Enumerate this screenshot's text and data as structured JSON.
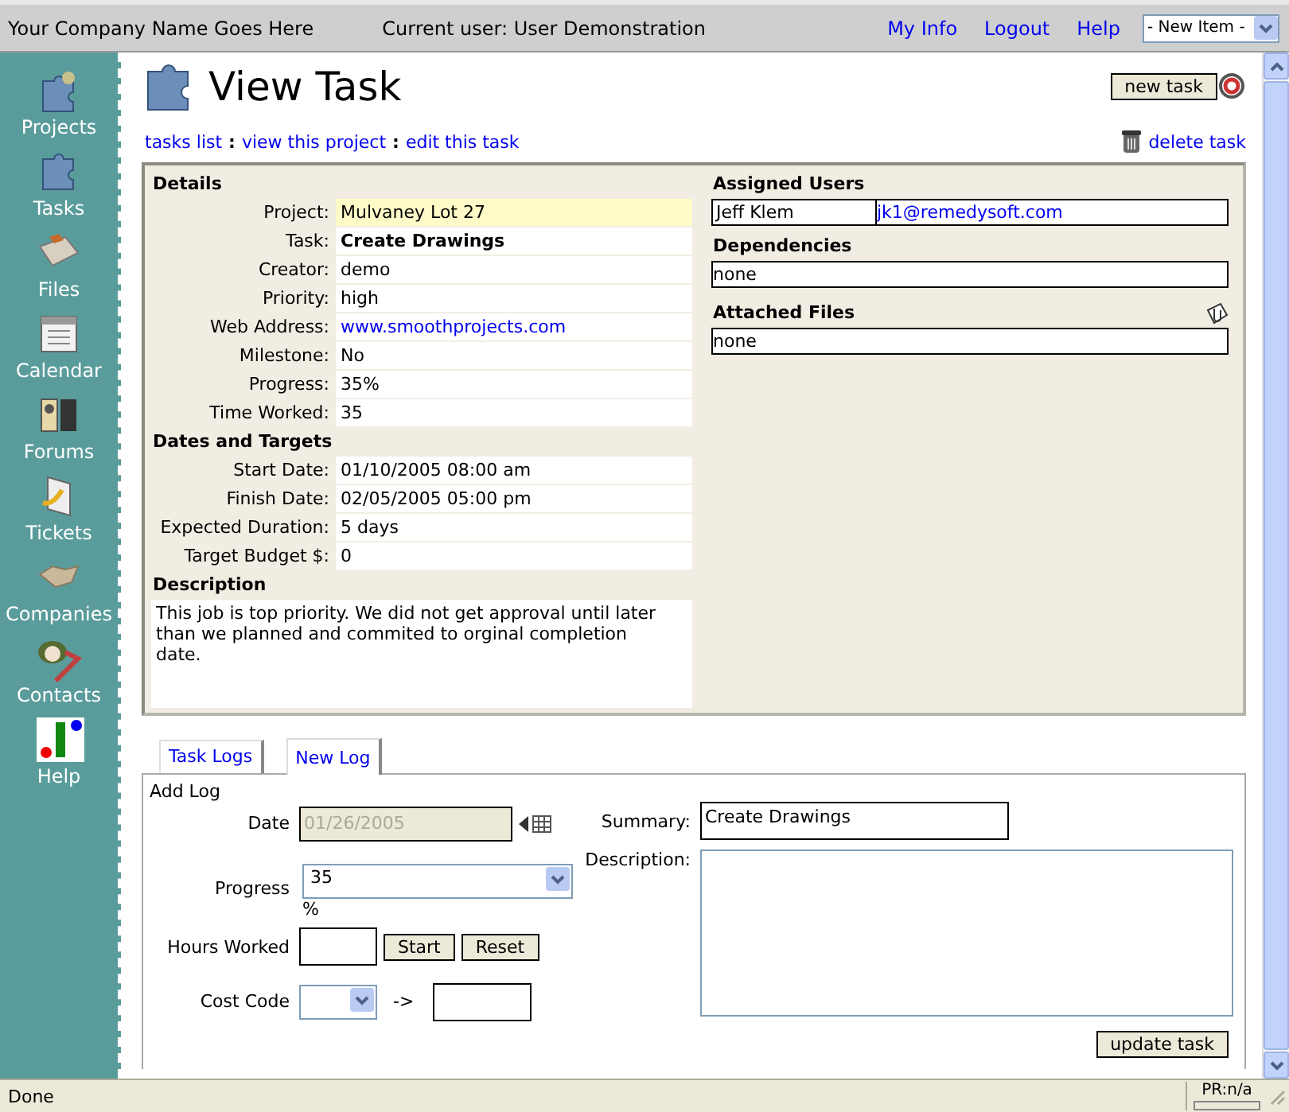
{
  "header": {
    "company": "Your Company Name Goes Here",
    "current_user": "Current user: User Demonstration",
    "links": [
      "My Info",
      "Logout",
      "Help"
    ],
    "new_item_select": "- New Item -"
  },
  "sidebar": {
    "items": [
      {
        "label": "Projects",
        "kind": "projects"
      },
      {
        "label": "Tasks",
        "kind": "tasks"
      },
      {
        "label": "Files",
        "kind": "files"
      },
      {
        "label": "Calendar",
        "kind": "calendar"
      },
      {
        "label": "Forums",
        "kind": "forums"
      },
      {
        "label": "Tickets",
        "kind": "tickets"
      },
      {
        "label": "Companies",
        "kind": "companies"
      },
      {
        "label": "Contacts",
        "kind": "contacts"
      },
      {
        "label": "Help",
        "kind": "help"
      }
    ]
  },
  "page": {
    "title": "View Task",
    "new_task_button": "new task",
    "breadcrumbs": [
      {
        "kind": "link",
        "text": "tasks list"
      },
      {
        "kind": "separator",
        "text": ":"
      },
      {
        "kind": "link",
        "text": "view this project"
      },
      {
        "kind": "separator",
        "text": ":"
      },
      {
        "kind": "link",
        "text": "edit this task"
      }
    ],
    "delete_link": "delete task"
  },
  "details": {
    "sections": [
      {
        "heading": "Details",
        "rows": [
          {
            "label": "Project:",
            "value": "Mulvaney Lot 27",
            "kind": "text",
            "highlighted": true
          },
          {
            "label": "Task:",
            "value": "Create Drawings",
            "kind": "bold",
            "highlighted": false
          },
          {
            "label": "Creator:",
            "value": "demo",
            "kind": "text",
            "highlighted": false
          },
          {
            "label": "Priority:",
            "value": "high",
            "kind": "text",
            "highlighted": false
          },
          {
            "label": "Web Address:",
            "value": "www.smoothprojects.com",
            "kind": "link",
            "highlighted": false
          },
          {
            "label": "Milestone:",
            "value": "No",
            "kind": "text",
            "highlighted": false
          },
          {
            "label": "Progress:",
            "value": "35%",
            "kind": "text",
            "highlighted": false
          },
          {
            "label": "Time Worked:",
            "value": "35",
            "kind": "text",
            "highlighted": false
          }
        ]
      },
      {
        "heading": "Dates and Targets",
        "rows": [
          {
            "label": "Start Date:",
            "value": "01/10/2005 08:00 am",
            "kind": "text",
            "highlighted": false
          },
          {
            "label": "Finish Date:",
            "value": "02/05/2005 05:00 pm",
            "kind": "text",
            "highlighted": false
          },
          {
            "label": "Expected Duration:",
            "value": "5 days",
            "kind": "text",
            "highlighted": false
          },
          {
            "label": "Target Budget $:",
            "value": "0",
            "kind": "text",
            "highlighted": false
          }
        ]
      }
    ],
    "description": {
      "heading": "Description",
      "text": "This job is top priority. We did not get approval until later than we planned and commited to orginal completion date."
    },
    "assigned_users": {
      "heading": "Assigned Users",
      "rows": [
        {
          "name": "Jeff Klem",
          "email": "jk1@remedysoft.com"
        }
      ]
    },
    "dependencies": {
      "heading": "Dependencies",
      "items": [
        "none"
      ]
    },
    "attached_files": {
      "heading": "Attached Files",
      "items": [
        "none"
      ]
    }
  },
  "tabs": [
    {
      "label": "Task Logs",
      "selected": false
    },
    {
      "label": "New Log",
      "selected": true
    }
  ],
  "log_form": {
    "heading": "Add Log",
    "date": {
      "label": "Date",
      "value": "01/26/2005",
      "disabled": true
    },
    "summary": {
      "label": "Summary:",
      "value": "Create Drawings"
    },
    "progress": {
      "label": "Progress",
      "value": "35",
      "unit": "%"
    },
    "description": {
      "label": "Description:"
    },
    "hours": {
      "label": "Hours Worked",
      "start_button": "Start",
      "reset_button": "Reset"
    },
    "cost_code": {
      "label": "Cost Code",
      "arrow": "->"
    },
    "submit_button": "update task"
  },
  "status_bar": {
    "text": "Done",
    "zone": "PR:n/a"
  }
}
